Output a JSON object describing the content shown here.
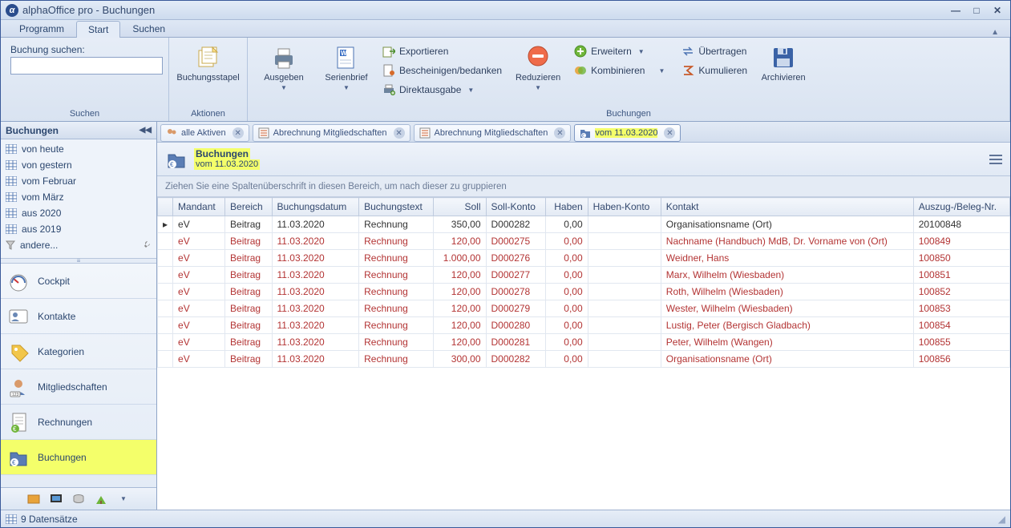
{
  "window": {
    "title": "alphaOffice pro - Buchungen"
  },
  "menu": {
    "programm": "Programm",
    "start": "Start",
    "suchen": "Suchen"
  },
  "ribbon": {
    "search_label": "Buchung suchen:",
    "search_value": "",
    "groups": {
      "suchen": "Suchen",
      "aktionen": "Aktionen",
      "buchungen": "Buchungen"
    },
    "buchungsstapel": "Buchungsstapel",
    "ausgeben": "Ausgeben",
    "serienbrief": "Serienbrief",
    "exportieren": "Exportieren",
    "bescheinigen": "Bescheinigen/bedanken",
    "direktausgabe": "Direktausgabe",
    "reduzieren": "Reduzieren",
    "erweitern": "Erweitern",
    "kombinieren": "Kombinieren",
    "uebertragen": "Übertragen",
    "kumulieren": "Kumulieren",
    "archivieren": "Archivieren"
  },
  "left": {
    "header": "Buchungen",
    "items": [
      "von heute",
      "von gestern",
      "vom Februar",
      "vom März",
      "aus 2020",
      "aus 2019",
      "andere..."
    ],
    "nav": {
      "cockpit": "Cockpit",
      "kontakte": "Kontakte",
      "kategorien": "Kategorien",
      "mitgliedschaften": "Mitgliedschaften",
      "rechnungen": "Rechnungen",
      "buchungen": "Buchungen"
    }
  },
  "tabs": {
    "alle_aktiven": "alle Aktiven",
    "abr1": "Abrechnung Mitgliedschaften",
    "abr2": "Abrechnung Mitgliedschaften",
    "vom": "vom 11.03.2020"
  },
  "doc_header": {
    "title": "Buchungen",
    "subtitle": "vom 11.03.2020"
  },
  "group_hint": "Ziehen Sie eine Spaltenüberschrift in diesen Bereich, um nach dieser zu gruppieren",
  "columns": {
    "mandant": "Mandant",
    "bereich": "Bereich",
    "buchungsdatum": "Buchungsdatum",
    "buchungstext": "Buchungstext",
    "soll": "Soll",
    "sollkonto": "Soll-Konto",
    "haben": "Haben",
    "habenkonto": "Haben-Konto",
    "kontakt": "Kontakt",
    "auszug": "Auszug-/Beleg-Nr."
  },
  "rows": [
    {
      "mandant": "eV",
      "bereich": "Beitrag",
      "datum": "11.03.2020",
      "text": "Rechnung",
      "soll": "350,00",
      "sollk": "D000282",
      "haben": "0,00",
      "habenk": "",
      "kontakt": "Organisationsname (Ort)",
      "beleg": "20100848",
      "red": false,
      "ptr": true
    },
    {
      "mandant": "eV",
      "bereich": "Beitrag",
      "datum": "11.03.2020",
      "text": "Rechnung",
      "soll": "120,00",
      "sollk": "D000275",
      "haben": "0,00",
      "habenk": "",
      "kontakt": "Nachname (Handbuch) MdB, Dr. Vorname von (Ort)",
      "beleg": "100849",
      "red": true
    },
    {
      "mandant": "eV",
      "bereich": "Beitrag",
      "datum": "11.03.2020",
      "text": "Rechnung",
      "soll": "1.000,00",
      "sollk": "D000276",
      "haben": "0,00",
      "habenk": "",
      "kontakt": "Weidner, Hans",
      "beleg": "100850",
      "red": true
    },
    {
      "mandant": "eV",
      "bereich": "Beitrag",
      "datum": "11.03.2020",
      "text": "Rechnung",
      "soll": "120,00",
      "sollk": "D000277",
      "haben": "0,00",
      "habenk": "",
      "kontakt": "Marx, Wilhelm (Wiesbaden)",
      "beleg": "100851",
      "red": true
    },
    {
      "mandant": "eV",
      "bereich": "Beitrag",
      "datum": "11.03.2020",
      "text": "Rechnung",
      "soll": "120,00",
      "sollk": "D000278",
      "haben": "0,00",
      "habenk": "",
      "kontakt": "Roth, Wilhelm (Wiesbaden)",
      "beleg": "100852",
      "red": true
    },
    {
      "mandant": "eV",
      "bereich": "Beitrag",
      "datum": "11.03.2020",
      "text": "Rechnung",
      "soll": "120,00",
      "sollk": "D000279",
      "haben": "0,00",
      "habenk": "",
      "kontakt": "Wester, Wilhelm (Wiesbaden)",
      "beleg": "100853",
      "red": true
    },
    {
      "mandant": "eV",
      "bereich": "Beitrag",
      "datum": "11.03.2020",
      "text": "Rechnung",
      "soll": "120,00",
      "sollk": "D000280",
      "haben": "0,00",
      "habenk": "",
      "kontakt": "Lustig, Peter (Bergisch Gladbach)",
      "beleg": "100854",
      "red": true
    },
    {
      "mandant": "eV",
      "bereich": "Beitrag",
      "datum": "11.03.2020",
      "text": "Rechnung",
      "soll": "120,00",
      "sollk": "D000281",
      "haben": "0,00",
      "habenk": "",
      "kontakt": "Peter, Wilhelm (Wangen)",
      "beleg": "100855",
      "red": true
    },
    {
      "mandant": "eV",
      "bereich": "Beitrag",
      "datum": "11.03.2020",
      "text": "Rechnung",
      "soll": "300,00",
      "sollk": "D000282",
      "haben": "0,00",
      "habenk": "",
      "kontakt": "Organisationsname (Ort)",
      "beleg": "100856",
      "red": true
    }
  ],
  "status": {
    "count": "9 Datensätze"
  }
}
